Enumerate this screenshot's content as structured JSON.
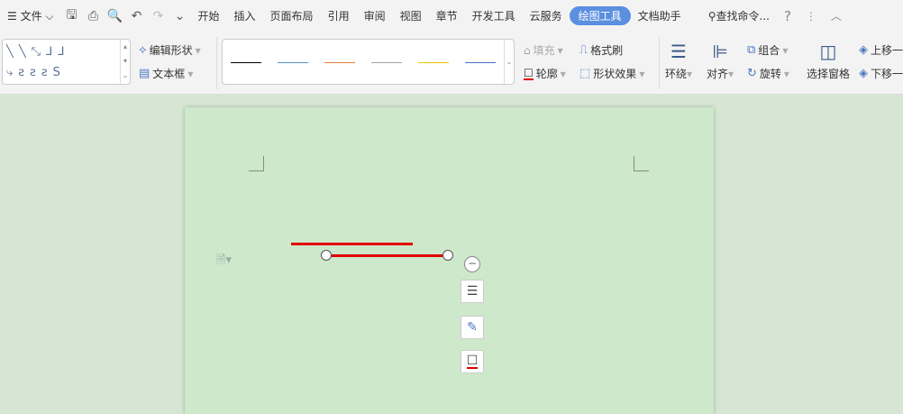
{
  "menubar": {
    "file": "文件",
    "tabs": [
      "开始",
      "插入",
      "页面布局",
      "引用",
      "审阅",
      "视图",
      "章节",
      "开发工具",
      "云服务",
      "绘图工具",
      "文档助手"
    ],
    "active_tab": "绘图工具",
    "search": "查找命令...",
    "help": "?"
  },
  "ribbon": {
    "edit_shape": "编辑形状",
    "text_box": "文本框",
    "fill": "填充",
    "format_painter": "格式刷",
    "outline": "轮廓",
    "shape_effects": "形状效果",
    "wrap": "环绕",
    "align": "对齐",
    "group": "组合",
    "rotate": "旋转",
    "selection_pane": "选择窗格",
    "bring_forward": "上移一",
    "send_backward": "下移一"
  },
  "line_styles": [
    "#000000",
    "#5b8fc7",
    "#e07b39",
    "#a5a5a5",
    "#f2c500",
    "#4472c4"
  ],
  "colors": {
    "accent": "#5b8fe0",
    "line": "#e00000"
  }
}
